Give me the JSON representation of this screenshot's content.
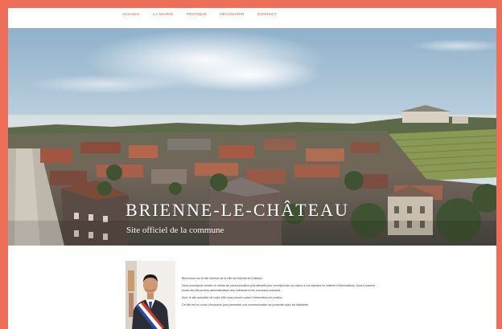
{
  "nav": {
    "items": [
      {
        "label": "ACCUEIL"
      },
      {
        "label": "LA MAIRIE"
      },
      {
        "label": "PRATIQUE"
      },
      {
        "label": "DÉCOUVRIR"
      },
      {
        "label": "CONTACT"
      }
    ]
  },
  "hero": {
    "title": "BRIENNE-LE-CHÂTEAU",
    "subtitle": "Site officiel de la commune",
    "image": "aerial-town-panorama"
  },
  "main": {
    "portrait": "mayor-portrait",
    "paragraphs": [
      "Bienvenue sur le site internet de la ville de Brienne-le-Château.",
      "Nous souhaitons rendre ce média de communication plus attractif pour correspondre au mieux à vos besoins en matière d'informations. Vous trouverez toutes les démarches administratives des habitants et les nouveaux arrivants.",
      "Avec le site actualisé de notre ville vous pouvez suivre l'information en continu.",
      "Ce site est en cours d'évolution pour permettre une communication de proximité avec les habitants."
    ]
  },
  "colors": {
    "frame": "#ee6f59",
    "nav_text": "#d65a46",
    "background": "#ffffff",
    "hero_text": "#ffffff"
  }
}
